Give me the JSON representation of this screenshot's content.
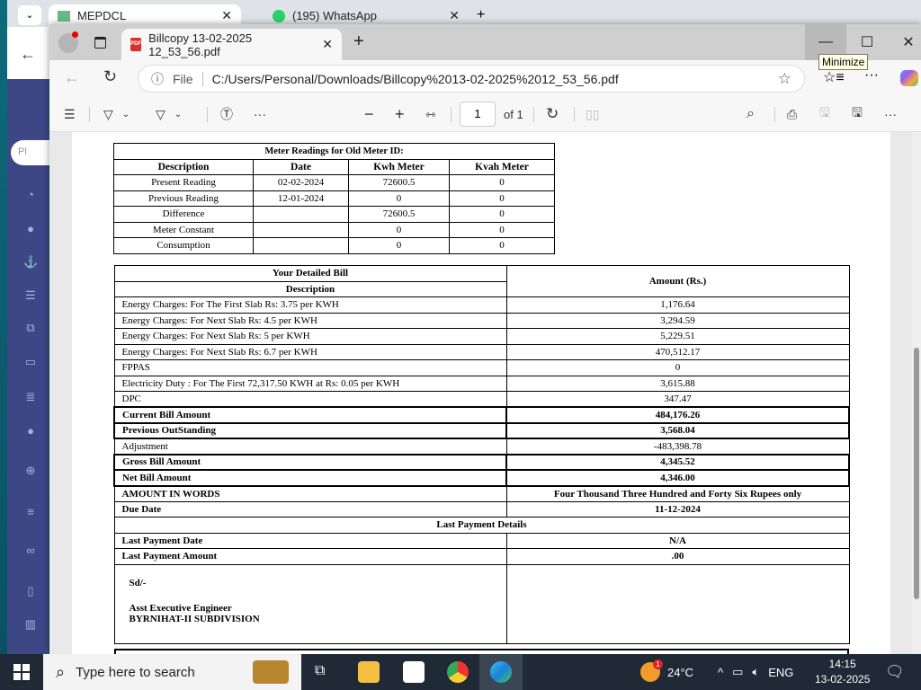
{
  "background_browser": {
    "tabs": [
      {
        "title": "MEPDCL"
      },
      {
        "title": "(195) WhatsApp"
      }
    ],
    "search_stub": "Pl"
  },
  "browser": {
    "tab_title": "Billcopy 13-02-2025 12_53_56.pdf",
    "address_scheme": "File",
    "url": "C:/Users/Personal/Downloads/Billcopy%2013-02-2025%2012_53_56.pdf",
    "tooltip": "Minimize"
  },
  "pdf_toolbar": {
    "page_number": "1",
    "page_total": "of 1"
  },
  "meter_table": {
    "title": "Meter Readings for Old Meter ID:",
    "headers": [
      "Description",
      "Date",
      "Kwh Meter",
      "Kvah Meter"
    ],
    "rows": [
      [
        "Present Reading",
        "02-02-2024",
        "72600.5",
        "0"
      ],
      [
        "Previous Reading",
        "12-01-2024",
        "0",
        "0"
      ],
      [
        "Difference",
        "",
        "72600.5",
        "0"
      ],
      [
        "Meter Constant",
        "",
        "0",
        "0"
      ],
      [
        "Consumption",
        "",
        "0",
        "0"
      ]
    ]
  },
  "bill_table": {
    "title": "Your Detailed Bill",
    "desc_header": "Description",
    "amount_header": "Amount (Rs.)",
    "charges": [
      [
        "Energy Charges: For The First Slab Rs: 3.75 per KWH",
        "1,176.64"
      ],
      [
        "Energy Charges: For Next Slab Rs: 4.5 per KWH",
        "3,294.59"
      ],
      [
        "Energy Charges: For Next Slab Rs: 5 per KWH",
        "5,229.51"
      ],
      [
        "Energy Charges: For Next Slab Rs: 6.7 per KWH",
        "470,512.17"
      ],
      [
        "FPPAS",
        "0"
      ],
      [
        "Electricity Duty : For The First 72,317.50 KWH at Rs: 0.05 per KWH",
        "3,615.88"
      ],
      [
        "DPC",
        "347.47"
      ]
    ],
    "current_bill": [
      "Current Bill Amount",
      "484,176.26"
    ],
    "previous_outstanding": [
      "Previous OutStanding",
      "3,568.04"
    ],
    "adjustment": [
      "Adjustment",
      "-483,398.78"
    ],
    "gross_bill": [
      "Gross Bill Amount",
      "4,345.52"
    ],
    "net_bill": [
      "Net Bill Amount",
      "4,346.00"
    ],
    "amount_words": [
      "AMOUNT IN WORDS",
      "Four Thousand Three Hundred and Forty Six Rupees only"
    ],
    "due_date": [
      "Due Date",
      "11-12-2024"
    ],
    "last_payment_title": "Last Payment Details",
    "last_payment_date": [
      "Last Payment Date",
      "N/A"
    ],
    "last_payment_amount": [
      "Last Payment Amount",
      ".00"
    ],
    "signature": {
      "sd": "Sd/-",
      "designation": "Asst Executive Engineer",
      "office": "BYRNIHAT-II SUBDIVISION"
    }
  },
  "taskbar": {
    "search_placeholder": "Type here to search",
    "weather": "24°C",
    "weather_badge": "1",
    "language": "ENG",
    "time": "14:15",
    "date": "13-02-2025"
  }
}
